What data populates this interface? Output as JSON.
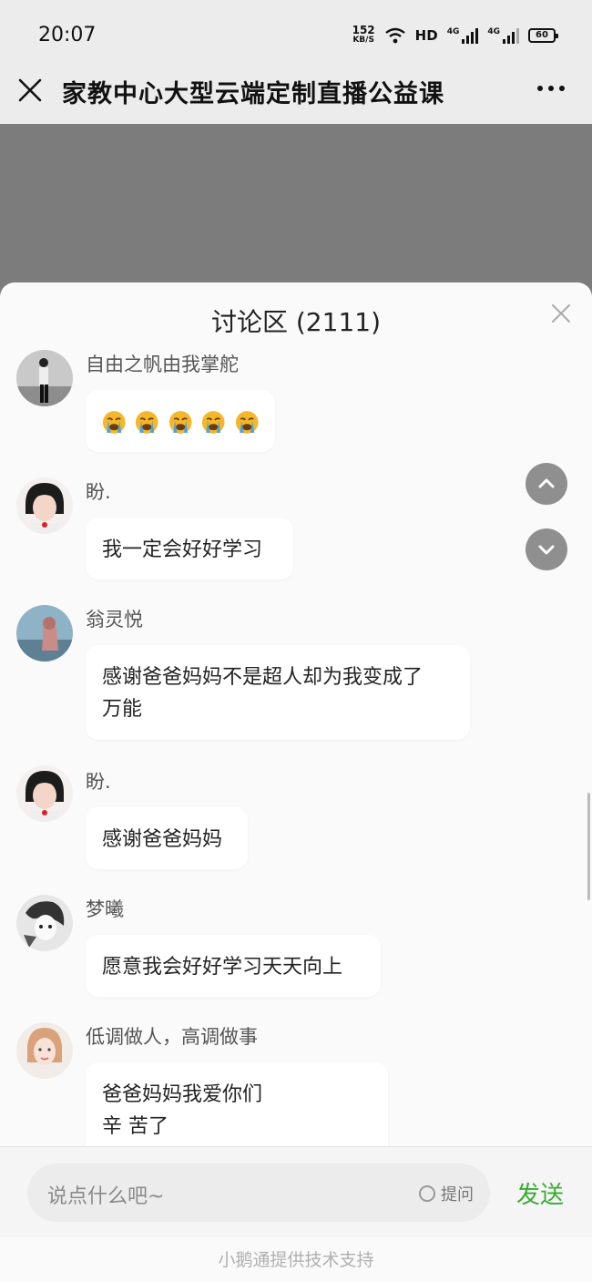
{
  "status_bar": {
    "time": "20:07",
    "net_speed_value": "152",
    "net_speed_unit": "KB/S",
    "hd_label": "HD",
    "signal1_label": "4G",
    "signal2_label": "4G",
    "battery": "60"
  },
  "nav": {
    "title": "家教中心大型云端定制直播公益课"
  },
  "panel": {
    "title": "讨论区 (2111)"
  },
  "messages": [
    {
      "username": "自由之帆由我掌舵",
      "emoji_count": 5,
      "emoji_name": "loudly-crying-face"
    },
    {
      "username": "盼.",
      "text": "我一定会好好学习"
    },
    {
      "username": "翁灵悦",
      "text_line1": "感谢爸爸妈妈不是超人却为我变成了",
      "text_line2": "万能"
    },
    {
      "username": "盼.",
      "text": "感谢爸爸妈妈"
    },
    {
      "username": "梦曦",
      "text": "愿意我会好好学习天天向上"
    },
    {
      "username": "低调做人，高调做事",
      "text_line1": "爸爸妈妈我爱你们",
      "text_line2": "辛 苦了"
    }
  ],
  "input": {
    "placeholder": "说点什么吧~",
    "ask_label": "提问",
    "send_label": "发送"
  },
  "footer": {
    "text": "小鹅通提供技术支持"
  },
  "colors": {
    "send_green": "#3caa34",
    "emoji_yellow": "#f5b72a"
  }
}
